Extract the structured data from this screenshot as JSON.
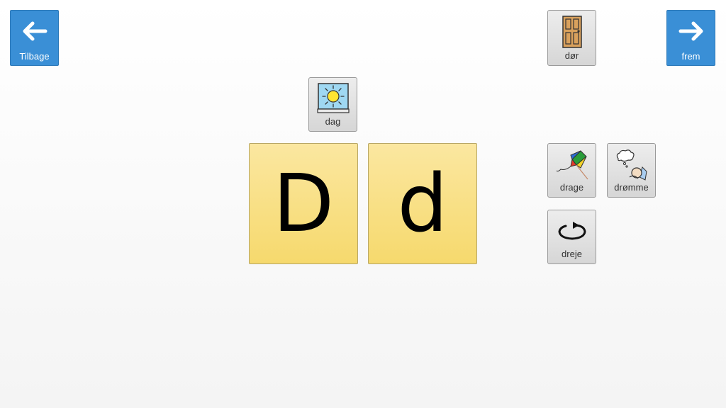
{
  "nav": {
    "back_label": "Tilbage",
    "forward_label": "frem",
    "color": "#3a8fd6"
  },
  "words": {
    "dag": {
      "label": "dag",
      "icon": "sun-window-icon"
    },
    "dor": {
      "label": "dør",
      "icon": "door-icon"
    },
    "drage": {
      "label": "drage",
      "icon": "kite-icon"
    },
    "dromme": {
      "label": "drømme",
      "icon": "dreaming-person-icon"
    },
    "dreje": {
      "label": "dreje",
      "icon": "rotate-arrow-icon"
    }
  },
  "letters": {
    "upper": "D",
    "lower": "d",
    "color": "#f8df84"
  }
}
